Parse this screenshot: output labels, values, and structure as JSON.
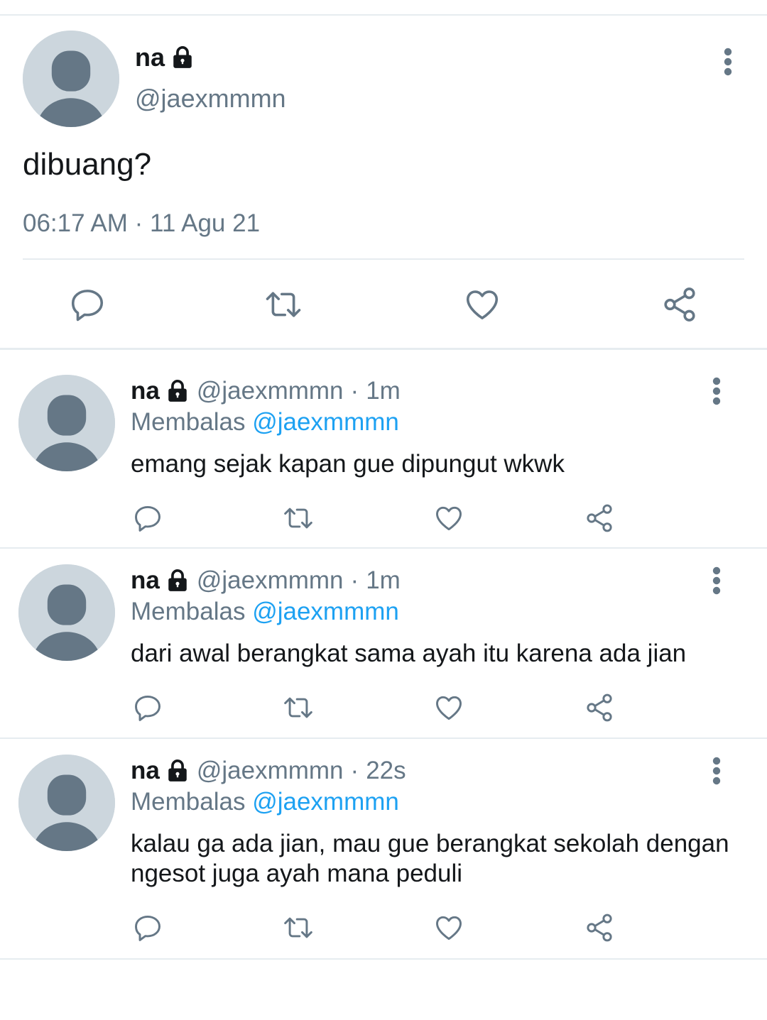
{
  "colors": {
    "text_primary": "#14171a",
    "text_secondary": "#657786",
    "link": "#1da1f2",
    "divider": "#e6ecf0",
    "avatar_bg": "#ccd6dd",
    "avatar_fg": "#657786"
  },
  "main_tweet": {
    "name": "na",
    "handle": "@jaexmmmn",
    "text": "dibuang?",
    "timestamp": "06:17 AM · 11 Agu 21",
    "icons": [
      "lock-icon",
      "more-vertical-icon",
      "reply-icon",
      "retweet-icon",
      "like-icon",
      "share-icon"
    ]
  },
  "replies": [
    {
      "name": "na",
      "handle": "@jaexmmmn",
      "dot": "·",
      "time": "1m",
      "replying_label": "Membalas",
      "replying_to": "@jaexmmmn",
      "text": "emang sejak kapan gue dipungut wkwk"
    },
    {
      "name": "na",
      "handle": "@jaexmmmn",
      "dot": "·",
      "time": "1m",
      "replying_label": "Membalas",
      "replying_to": "@jaexmmmn",
      "text": "dari awal berangkat sama ayah itu karena ada jian"
    },
    {
      "name": "na",
      "handle": "@jaexmmmn",
      "dot": "·",
      "time": "22s",
      "replying_label": "Membalas",
      "replying_to": "@jaexmmmn",
      "text": "kalau ga ada jian, mau gue berangkat sekolah dengan ngesot juga ayah mana peduli"
    }
  ]
}
